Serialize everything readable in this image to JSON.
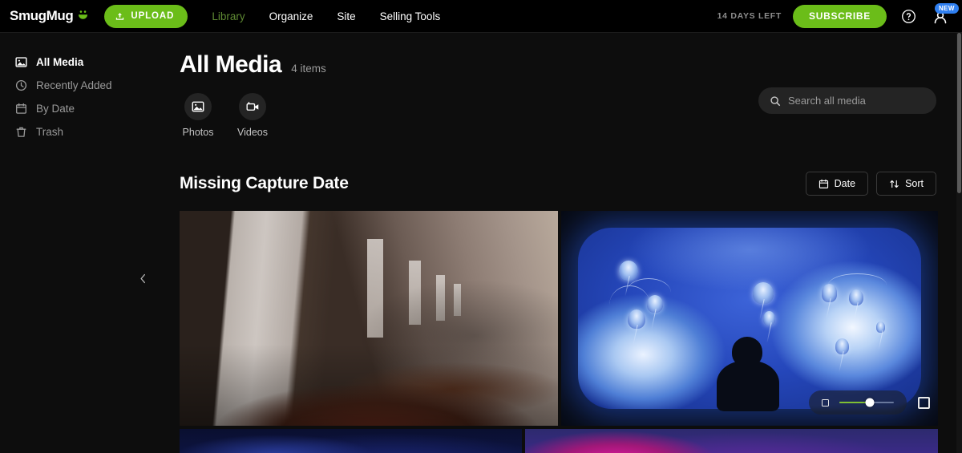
{
  "topbar": {
    "logo_text": "SmugMug",
    "logo_icon": "smiley-face-icon",
    "upload_label": "UPLOAD",
    "upload_icon": "upload-arrow-icon",
    "nav": [
      {
        "label": "Library",
        "active": true
      },
      {
        "label": "Organize",
        "active": false
      },
      {
        "label": "Site",
        "active": false
      },
      {
        "label": "Selling Tools",
        "active": false
      }
    ],
    "days_left": "14 DAYS LEFT",
    "subscribe_label": "SUBSCRIBE",
    "help_icon": "question-mark-circle-icon",
    "avatar_icon": "user-avatar-icon",
    "new_badge": "NEW",
    "accent_green": "#6bbd19",
    "active_nav_green": "#5f8a33",
    "badge_blue": "#2f7ff0"
  },
  "sidebar": {
    "items": [
      {
        "label": "All Media",
        "icon": "image-icon",
        "active": true
      },
      {
        "label": "Recently Added",
        "icon": "clock-icon",
        "active": false
      },
      {
        "label": "By Date",
        "icon": "calendar-icon",
        "active": false
      },
      {
        "label": "Trash",
        "icon": "trash-icon",
        "active": false
      }
    ],
    "collapse_icon": "chevron-left-icon"
  },
  "main": {
    "page_title": "All Media",
    "item_count": "4 items",
    "search": {
      "placeholder": "Search all media",
      "value": "",
      "icon": "search-icon"
    },
    "type_filters": [
      {
        "label": "Photos",
        "icon": "image-icon"
      },
      {
        "label": "Videos",
        "icon": "video-camera-icon"
      }
    ],
    "section": {
      "title": "Missing Capture Date",
      "actions": [
        {
          "label": "Date",
          "icon": "calendar-icon"
        },
        {
          "label": "Sort",
          "icon": "sort-arrows-icon"
        }
      ]
    },
    "size_control": {
      "small_icon": "small-square-icon",
      "large_icon": "large-square-icon",
      "value": 56,
      "fill_color": "#7fbf33"
    },
    "grid": {
      "rows": [
        {
          "tiles": [
            {
              "name": "concrete-corridor-photo",
              "alt": "Concrete corridor with columns, cloudy sky and red groundcover"
            },
            {
              "name": "jellyfish-aquarium-photo",
              "alt": "Child silhouette watching jellyfish in a blue aquarium tank"
            }
          ]
        },
        {
          "tiles": [
            {
              "name": "dark-blue-night-photo",
              "alt": "Dark blue night scene"
            },
            {
              "name": "magenta-nebula-photo",
              "alt": "Magenta and purple nebula night sky"
            }
          ]
        }
      ]
    }
  }
}
